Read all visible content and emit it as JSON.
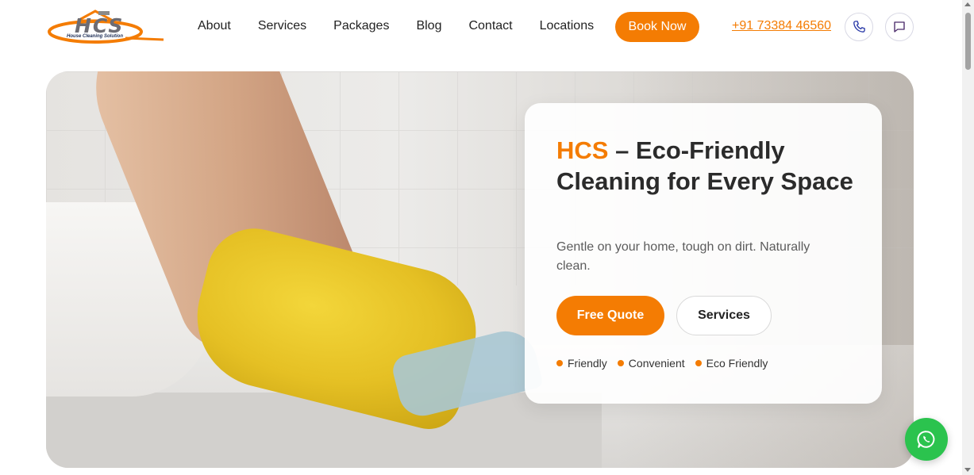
{
  "header": {
    "logo": {
      "text": "HCS",
      "tagline": "House Cleaning Solution"
    },
    "nav": [
      "About",
      "Services",
      "Packages",
      "Blog",
      "Contact",
      "Locations"
    ],
    "book_label": "Book Now",
    "phone": "+91 73384 46560",
    "icons": {
      "call": "phone-icon",
      "chat": "message-icon"
    }
  },
  "hero": {
    "title_brand": "HCS",
    "title_rest": " – Eco-Friendly Cleaning for Every Space",
    "subtitle": "Gentle on your home, tough on dirt. Naturally clean.",
    "primary_cta": "Free Quote",
    "secondary_cta": "Services",
    "features": [
      "Friendly",
      "Convenient",
      "Eco Friendly"
    ]
  },
  "floating": {
    "whatsapp_icon": "whatsapp-icon"
  },
  "colors": {
    "accent": "#f47c03",
    "whatsapp": "#2bc34e",
    "text": "#2b2b2b"
  }
}
